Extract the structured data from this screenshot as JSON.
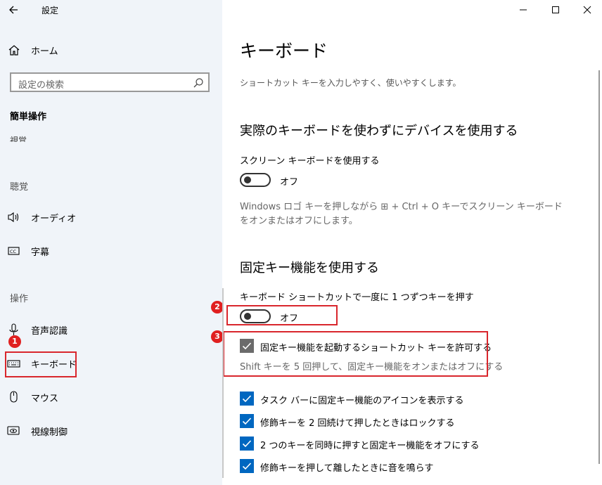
{
  "window": {
    "title": "設定",
    "controls": [
      "minimize-icon",
      "maximize-icon",
      "close-icon"
    ]
  },
  "sidebar": {
    "home_label": "ホーム",
    "search_placeholder": "設定の検索",
    "section_main": "簡単操作",
    "section_cut_text": "視覚",
    "section_hearing": "聴覚",
    "section_operation": "操作",
    "items": [
      {
        "label": "オーディオ",
        "icon": "speaker-icon"
      },
      {
        "label": "字幕",
        "icon": "closed-caption-icon"
      },
      {
        "label": "音声認識",
        "icon": "microphone-icon"
      },
      {
        "label": "キーボード",
        "icon": "keyboard-icon",
        "selected": true
      },
      {
        "label": "マウス",
        "icon": "mouse-icon"
      },
      {
        "label": "視線制御",
        "icon": "eye-icon"
      }
    ]
  },
  "main": {
    "page_title": "キーボード",
    "page_desc": "ショートカット キーを入力しやすく、使いやすくします。",
    "onscreen": {
      "heading": "実際のキーボードを使わずにデバイスを使用する",
      "toggle_label": "スクリーン キーボードを使用する",
      "toggle_state": "オフ",
      "note": "Windows ロゴ キーを押しながら ⊞ + Ctrl + O キーでスクリーン キーボードをオンまたはオフにします。"
    },
    "sticky": {
      "heading": "固定キー機能を使用する",
      "toggle_label": "キーボード ショートカットで一度に 1 つずつキーを押す",
      "toggle_state": "オフ",
      "shortcut_option": "固定キー機能を起動するショートカット キーを許可する",
      "shortcut_sub": "Shift キーを 5 回押して、固定キー機能をオンまたはオフにする",
      "options": [
        "タスク バーに固定キー機能のアイコンを表示する",
        "修飾キーを 2 回続けて押したときはロックする",
        "2 つのキーを同時に押すと固定キー機能をオフにする",
        "修飾キーを押して離したときに音を鳴らす"
      ]
    }
  },
  "annotations": {
    "badge_1": "1",
    "badge_2": "2",
    "badge_3": "3",
    "highlight_color": "#d9262c"
  },
  "colors": {
    "sidebar_bg": "#f0f4f9",
    "checkbox_blue": "#0067c0",
    "checkbox_gray": "#6b6b6b"
  }
}
